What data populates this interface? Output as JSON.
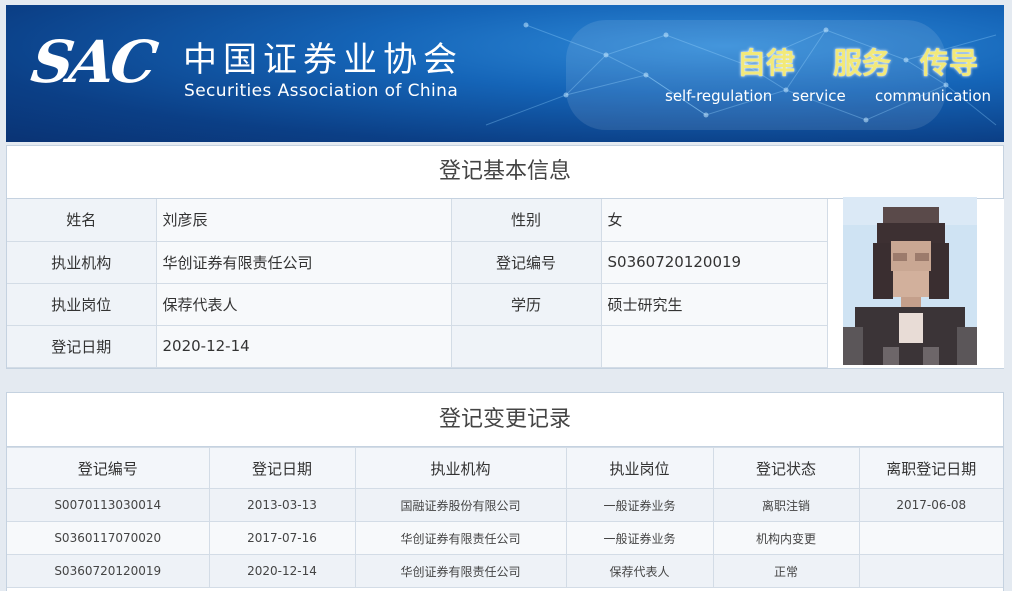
{
  "header": {
    "logo_text": "SAC",
    "org_name_cn": "中国证券业协会",
    "org_name_en": "Securities Association of China",
    "slogans": [
      {
        "cn": "自律",
        "en": "self-regulation"
      },
      {
        "cn": "服务",
        "en": "service"
      },
      {
        "cn": "传导",
        "en": "communication"
      }
    ]
  },
  "basic_info": {
    "title": "登记基本信息",
    "fields": {
      "name_label": "姓名",
      "name": "刘彦辰",
      "gender_label": "性别",
      "gender": "女",
      "institution_label": "执业机构",
      "institution": "华创证券有限责任公司",
      "reg_no_label": "登记编号",
      "reg_no": "S0360720120019",
      "position_label": "执业岗位",
      "position": "保荐代表人",
      "education_label": "学历",
      "education": "硕士研究生",
      "reg_date_label": "登记日期",
      "reg_date": "2020-12-14"
    }
  },
  "change_records": {
    "title": "登记变更记录",
    "columns": [
      "登记编号",
      "登记日期",
      "执业机构",
      "执业岗位",
      "登记状态",
      "离职登记日期"
    ],
    "rows": [
      [
        "S0070113030014",
        "2013-03-13",
        "国融证券股份有限公司",
        "一般证券业务",
        "离职注销",
        "2017-06-08"
      ],
      [
        "S0360117070020",
        "2017-07-16",
        "华创证券有限责任公司",
        "一般证券业务",
        "机构内变更",
        ""
      ],
      [
        "S0360720120019",
        "2020-12-14",
        "华创证券有限责任公司",
        "保荐代表人",
        "正常",
        ""
      ]
    ]
  }
}
